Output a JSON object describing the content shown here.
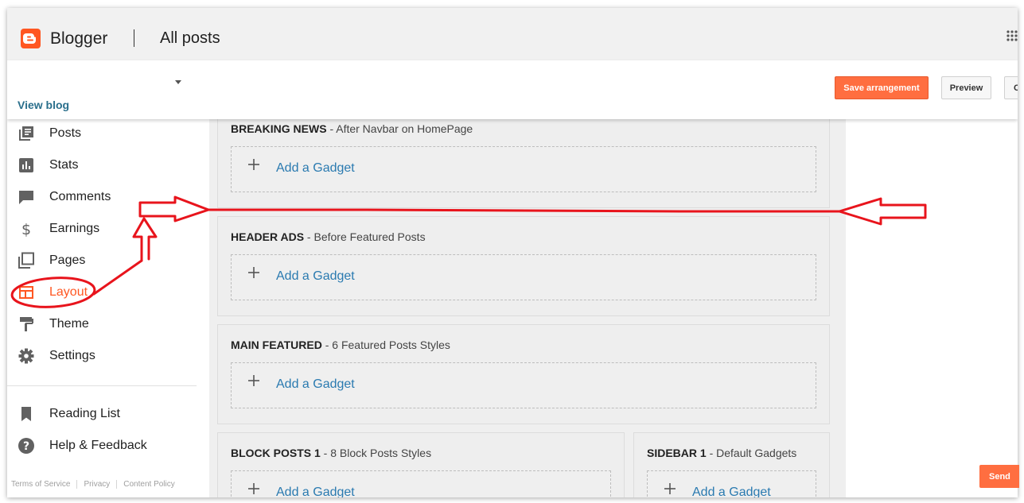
{
  "topbar": {
    "brand": "Blogger",
    "page_title": "All posts"
  },
  "actionbar": {
    "view_blog": "View blog",
    "save_label": "Save arrangement",
    "preview_label": "Preview",
    "clear_label": "C"
  },
  "sidebar": {
    "items": [
      {
        "label": "Posts",
        "icon": "posts-icon"
      },
      {
        "label": "Stats",
        "icon": "stats-icon"
      },
      {
        "label": "Comments",
        "icon": "comments-icon"
      },
      {
        "label": "Earnings",
        "icon": "dollar-icon"
      },
      {
        "label": "Pages",
        "icon": "pages-icon"
      },
      {
        "label": "Layout",
        "icon": "layout-icon",
        "active": true
      },
      {
        "label": "Theme",
        "icon": "paint-roller-icon"
      },
      {
        "label": "Settings",
        "icon": "gear-icon"
      }
    ],
    "secondary": [
      {
        "label": "Reading List",
        "icon": "bookmark-icon"
      },
      {
        "label": "Help & Feedback",
        "icon": "help-icon"
      }
    ],
    "footer": {
      "terms": "Terms of Service",
      "privacy": "Privacy",
      "content_policy": "Content Policy"
    }
  },
  "layout": {
    "add_gadget": "Add a Gadget",
    "sections": [
      {
        "name": "BREAKING NEWS",
        "desc": " - After Navbar on HomePage"
      },
      {
        "name": "HEADER ADS",
        "desc": " - Before Featured Posts"
      },
      {
        "name": "MAIN FEATURED",
        "desc": " - 6 Featured Posts Styles"
      },
      {
        "name": "BLOCK POSTS 1",
        "desc": " - 8 Block Posts Styles"
      },
      {
        "name": "SIDEBAR 1",
        "desc": " - Default Gadgets"
      }
    ]
  },
  "send_label": "Send",
  "colors": {
    "accent": "#ff5722",
    "button_orange": "#ff6e40",
    "link_blue": "#2a7ab0",
    "annotation_red": "#e8141c"
  }
}
